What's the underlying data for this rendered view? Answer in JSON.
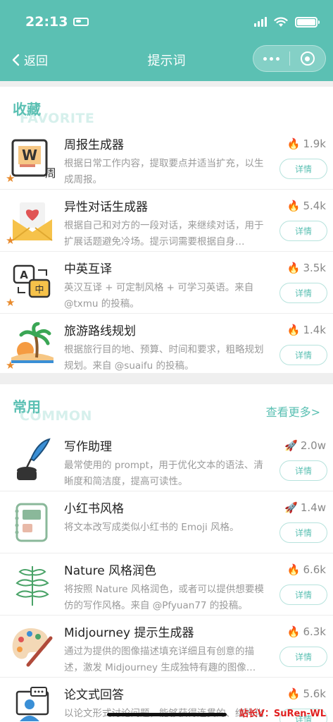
{
  "status_bar": {
    "time": "22:13"
  },
  "nav": {
    "back_label": "返回",
    "title": "提示词"
  },
  "favorite": {
    "title": "收藏",
    "subtitle": "FAVORITE",
    "items": [
      {
        "name": "周报生成器",
        "desc": "根据日常工作内容，提取要点并适当扩充，以生成周报。",
        "count_icon": "fire-icon",
        "count": "1.9k",
        "action": "详情",
        "icon": "weekly-report-icon"
      },
      {
        "name": "异性对话生成器",
        "desc": "根据自己和对方的一段对话，来继续对话，用于扩展话题避免冷场。提示词需要根据自身…",
        "count_icon": "fire-icon",
        "count": "5.4k",
        "action": "详情",
        "icon": "love-letter-icon"
      },
      {
        "name": "中英互译",
        "desc": "英汉互译 + 可定制风格 + 可学习英语。来自 @txmu 的投稿。",
        "count_icon": "fire-icon",
        "count": "3.5k",
        "action": "详情",
        "icon": "translate-icon"
      },
      {
        "name": "旅游路线规划",
        "desc": "根据旅行目的地、预算、时间和要求，粗略规划规划。来自 @suaifu 的投稿。",
        "count_icon": "fire-icon",
        "count": "1.4k",
        "action": "详情",
        "icon": "island-icon"
      }
    ]
  },
  "common": {
    "title": "常用",
    "subtitle": "COMMON",
    "more_label": "查看更多>",
    "items": [
      {
        "name": "写作助理",
        "desc": "最常使用的 prompt，用于优化文本的语法、清晰度和简洁度，提高可读性。",
        "count_icon": "rocket-icon",
        "count": "2.0w",
        "action": "详情",
        "icon": "quill-ink-icon"
      },
      {
        "name": "小红书风格",
        "desc": "将文本改写成类似小红书的 Emoji 风格。",
        "count_icon": "rocket-icon",
        "count": "1.4w",
        "action": "详情",
        "icon": "notebook-icon"
      },
      {
        "name": "Nature 风格润色",
        "desc": "将按照 Nature 风格润色，或者可以提供想要模仿的写作风格。来自 @Pfyuan77 的投稿。",
        "count_icon": "fire-icon",
        "count": "6.6k",
        "action": "详情",
        "icon": "leaf-icon"
      },
      {
        "name": "Midjourney 提示生成器",
        "desc": "通过为提供的图像描述填充详细且有创意的描述，激发 Midjourney 生成独特有趣的图像…",
        "count_icon": "fire-icon",
        "count": "6.3k",
        "action": "详情",
        "icon": "palette-icon"
      },
      {
        "name": "论文式回答",
        "desc": "以论文形式讨论问题，能够获得连贯的、结构化和更加专业的回答。",
        "count_icon": "fire-icon",
        "count": "5.6k",
        "action": "详情",
        "icon": "computer-user-icon"
      }
    ]
  },
  "watermark": "站长V：SuRen-WL",
  "colors": {
    "accent": "#5bc0b3",
    "star": "#e88a2c"
  }
}
